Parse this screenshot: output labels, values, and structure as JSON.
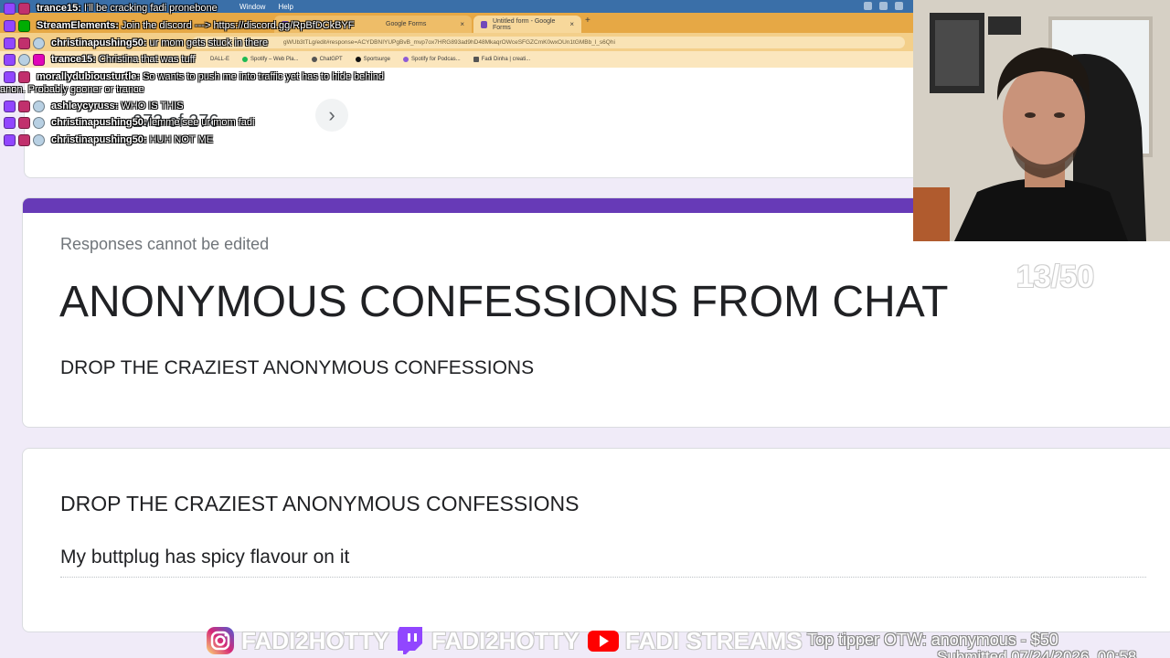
{
  "browser": {
    "menu": [
      "Window",
      "Help"
    ],
    "tabs": [
      {
        "label": "Google Forms"
      },
      {
        "label": "Untitled form - Google Forms"
      }
    ],
    "url": "gWUb3tTLg/edit#response=ACYDBNIYUPgBvB_mvp7ox7HRG893ad9hD48MkaqrOWceSFGZCmK0wxOUn1tGMBb_l_s6Qhi",
    "bookmarks": [
      "DALL-E",
      "Spotify – Web Pla...",
      "ChatGPT",
      "Sportsurge",
      "Spotify for Podcas...",
      "Fadi Dinha | creati..."
    ]
  },
  "navigator": {
    "count_text": "273   of   276",
    "next_glyph": "›"
  },
  "form": {
    "notice": "Responses cannot be edited",
    "title": "ANONYMOUS CONFESSIONS FROM CHAT",
    "description": "DROP THE CRAZIEST ANONYMOUS CONFESSIONS"
  },
  "question": {
    "title": "DROP THE CRAZIEST ANONYMOUS CONFESSIONS",
    "answer": "My buttplug has spicy flavour on it"
  },
  "chat": {
    "lines": [
      {
        "user": "trance15:",
        "message": " I'll be cracking fadi pronebone",
        "badges": [
          "mod",
          "sub"
        ]
      },
      {
        "user": "StreamElements:",
        "message": " Join the discord ---> https://discord.gg/RpBfDCkBYF",
        "badges": [
          "mod",
          "bot"
        ]
      },
      {
        "user": "christinapushing50:",
        "message": " ur mom gets stuck in there",
        "badges": [
          "mod",
          "sub",
          "gift"
        ]
      },
      {
        "user": "trance15:",
        "message": " Christina that was tuff",
        "badges": [
          "mod",
          "gift",
          "vip"
        ]
      },
      {
        "user": "morallydubiousturtle:",
        "message": " So wants to push me into traffic yet has to hide behind",
        "badges": [
          "mod",
          "sub"
        ]
      },
      {
        "user": "ashleycyruss:",
        "message": " WHO IS THIS",
        "badges": [
          "mod",
          "sub",
          "gift"
        ]
      },
      {
        "user": "christinapushing50:",
        "message": " lemme see ur mom fadi",
        "badges": [
          "mod",
          "sub",
          "gift"
        ]
      },
      {
        "user": "christinapushing50:",
        "message": " HUH NOT ME",
        "badges": [
          "mod",
          "sub",
          "gift"
        ]
      }
    ],
    "wrap_text": "anon. Probably gooner or trance"
  },
  "stream": {
    "counter": "13/50",
    "socials": [
      {
        "icon": "instagram-icon",
        "handle": "FADI2HOTTY"
      },
      {
        "icon": "twitch-icon",
        "handle": "FADI2HOTTY"
      },
      {
        "icon": "youtube-icon",
        "handle": "FADI STREAMS"
      }
    ],
    "top_tipper": "Top tipper OTW: anonymous - $50",
    "submitted": "Submitted 07/24/2026, 00:58"
  },
  "colors": {
    "form_accent": "#673ab7",
    "page_bg": "#f0ebf8",
    "browser_tab_bg": "#e6a845",
    "twitch": "#9146ff",
    "youtube": "#ff0000"
  }
}
